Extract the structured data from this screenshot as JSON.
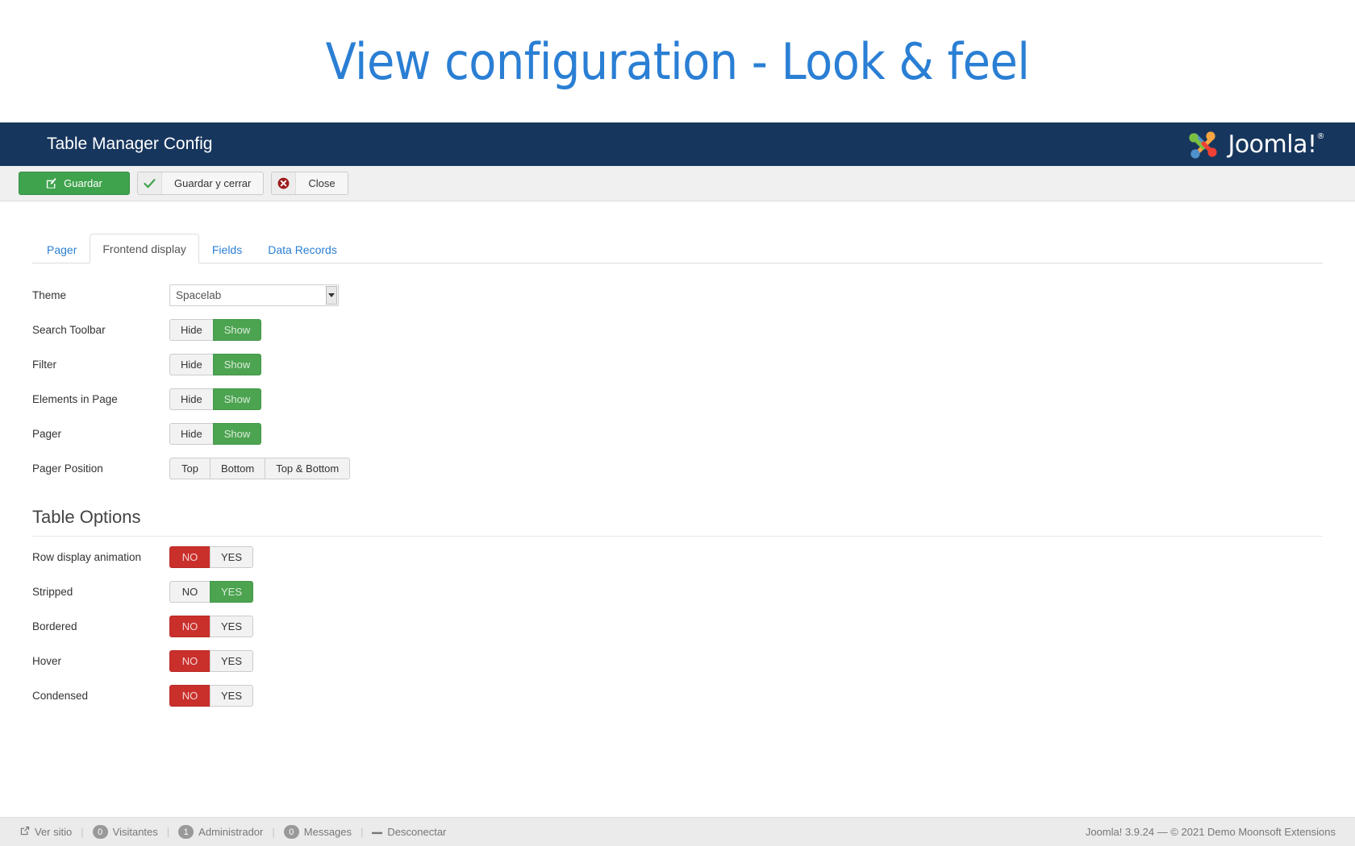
{
  "slide": {
    "title": "View configuration - Look & feel",
    "title_color": "#2a7fd4"
  },
  "admin_header": {
    "title": "Table Manager Config",
    "brand": "Joomla!",
    "brand_trademark": "®",
    "background_color": "#17365d"
  },
  "toolbar": {
    "save_label": "Guardar",
    "save_close_label": "Guardar y cerrar",
    "close_label": "Close",
    "save_icon": "pencil-square-icon",
    "save_close_icon": "check-icon",
    "close_icon": "circle-x-icon",
    "primary_color": "#3fa34d"
  },
  "tabs": [
    {
      "label": "Pager",
      "active": false
    },
    {
      "label": "Frontend display",
      "active": true
    },
    {
      "label": "Fields",
      "active": false
    },
    {
      "label": "Data Records",
      "active": false
    }
  ],
  "frontend_display": {
    "theme": {
      "label": "Theme",
      "value": "Spacelab",
      "options": [
        "Spacelab"
      ]
    },
    "toggles": [
      {
        "label": "Search Toolbar",
        "options": [
          "Hide",
          "Show"
        ],
        "selected": "Show",
        "state": "on-green"
      },
      {
        "label": "Filter",
        "options": [
          "Hide",
          "Show"
        ],
        "selected": "Show",
        "state": "on-green"
      },
      {
        "label": "Elements in Page",
        "options": [
          "Hide",
          "Show"
        ],
        "selected": "Show",
        "state": "on-green"
      },
      {
        "label": "Pager",
        "options": [
          "Hide",
          "Show"
        ],
        "selected": "Show",
        "state": "on-green"
      }
    ],
    "pager_position": {
      "label": "Pager Position",
      "options": [
        "Top",
        "Bottom",
        "Top & Bottom"
      ],
      "selected": ""
    }
  },
  "table_options": {
    "heading": "Table Options",
    "rows": [
      {
        "label": "Row display animation",
        "options": [
          "NO",
          "YES"
        ],
        "selected": "NO",
        "state": "on-red"
      },
      {
        "label": "Stripped",
        "options": [
          "NO",
          "YES"
        ],
        "selected": "YES",
        "state": "on-green"
      },
      {
        "label": "Bordered",
        "options": [
          "NO",
          "YES"
        ],
        "selected": "NO",
        "state": "on-red"
      },
      {
        "label": "Hover",
        "options": [
          "NO",
          "YES"
        ],
        "selected": "NO",
        "state": "on-red"
      },
      {
        "label": "Condensed",
        "options": [
          "NO",
          "YES"
        ],
        "selected": "NO",
        "state": "on-red"
      }
    ]
  },
  "footer": {
    "items": [
      {
        "icon": "external-link-icon",
        "badge": null,
        "label": "Ver sitio"
      },
      {
        "icon": null,
        "badge": "0",
        "label": "Visitantes"
      },
      {
        "icon": null,
        "badge": "1",
        "label": "Administrador"
      },
      {
        "icon": null,
        "badge": "0",
        "label": "Messages"
      },
      {
        "icon": "logout-icon",
        "badge": null,
        "label": "Desconectar"
      }
    ],
    "copyright": "Joomla! 3.9.24  —  © 2021 Demo Moonsoft Extensions"
  },
  "colors": {
    "green": "#4ca350",
    "red": "#c9302c",
    "header_blue": "#17365d",
    "link_blue": "#2a7fd4"
  }
}
